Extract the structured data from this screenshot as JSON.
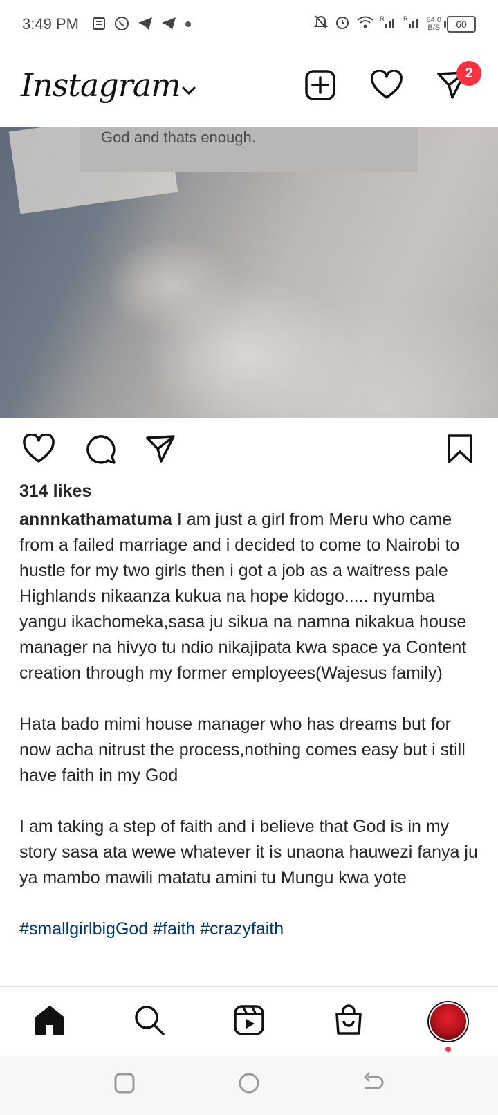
{
  "status_bar": {
    "time": "3:49 PM",
    "net_speed_value": "84.0",
    "net_speed_unit": "B/S",
    "battery": "60",
    "signal_labels": [
      "R",
      "R"
    ]
  },
  "header": {
    "app_title": "Instagram",
    "messages_badge": "2"
  },
  "post": {
    "image_overlay_text": "God and thats enough.",
    "likes": "314 likes",
    "username": "annnkathamatuma",
    "caption_para1": "I am just a girl from Meru who came from a failed marriage and i decided to come to Nairobi to hustle for my two girls  then i got a job as a waitress pale Highlands nikaanza kukua na hope kidogo..... nyumba yangu ikachomeka,sasa ju sikua na namna nikakua house manager na hivyo tu ndio nikajipata kwa space ya Content creation through my former employees(Wajesus family)",
    "caption_para2": "Hata bado mimi house manager who has dreams but for now acha nitrust the process,nothing comes easy but i still have faith in my God",
    "caption_para3": "I am taking a step of faith and i believe that God is in my story sasa ata wewe whatever it is unaona hauwezi fanya ju ya mambo mawili matatu amini tu Mungu kwa yote",
    "hashtags": "#smallgirlbigGod #faith #crazyfaith"
  },
  "icons": {
    "header": [
      "new-post-icon",
      "heart-icon",
      "direct-message-icon"
    ],
    "actions": [
      "like-icon",
      "comment-icon",
      "share-icon",
      "save-icon"
    ],
    "bottom_nav": [
      "home-icon",
      "search-icon",
      "reels-icon",
      "shop-icon",
      "profile-avatar"
    ],
    "system_nav": [
      "recents-icon",
      "home-circle-icon",
      "back-icon"
    ]
  },
  "colors": {
    "notification_badge": "#ff3040",
    "hashtag": "#00376b",
    "text": "#262626"
  }
}
